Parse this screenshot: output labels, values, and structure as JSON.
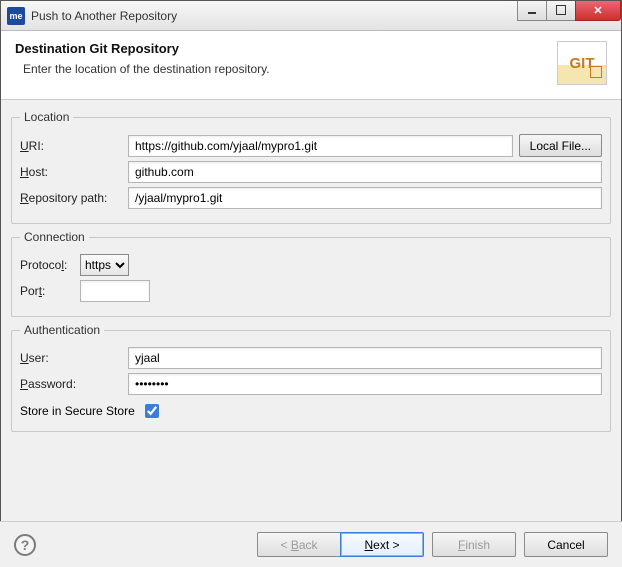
{
  "window": {
    "app_icon_text": "me",
    "title": "Push to Another Repository"
  },
  "header": {
    "title": "Destination Git Repository",
    "subtitle": "Enter the location of the destination repository.",
    "logo_text": "GIT"
  },
  "location": {
    "legend": "Location",
    "uri_label_pre": "U",
    "uri_label_post": "RI:",
    "uri_value": "https://github.com/yjaal/mypro1.git",
    "local_file_label": "Local File...",
    "host_label_pre": "H",
    "host_label_post": "ost:",
    "host_value": "github.com",
    "repo_label_pre": "R",
    "repo_label_post": "epository path:",
    "repo_value": "/yjaal/mypro1.git"
  },
  "connection": {
    "legend": "Connection",
    "protocol_label_pre": "Protoco",
    "protocol_label_ul": "l",
    "protocol_label_post": ":",
    "protocol_value": "https",
    "port_label_pre": "Por",
    "port_label_ul": "t",
    "port_label_post": ":",
    "port_value": ""
  },
  "auth": {
    "legend": "Authentication",
    "user_label_pre": "U",
    "user_label_post": "ser:",
    "user_value": "yjaal",
    "password_label_pre": "P",
    "password_label_post": "assword:",
    "password_value": "••••••••",
    "store_label_pre": "S",
    "store_label_post": "tore in Secure Store",
    "store_checked": true
  },
  "footer": {
    "back_pre": "< ",
    "back_ul": "B",
    "back_post": "ack",
    "next_ul": "N",
    "next_post": "ext >",
    "finish_ul": "F",
    "finish_post": "inish",
    "cancel": "Cancel"
  }
}
